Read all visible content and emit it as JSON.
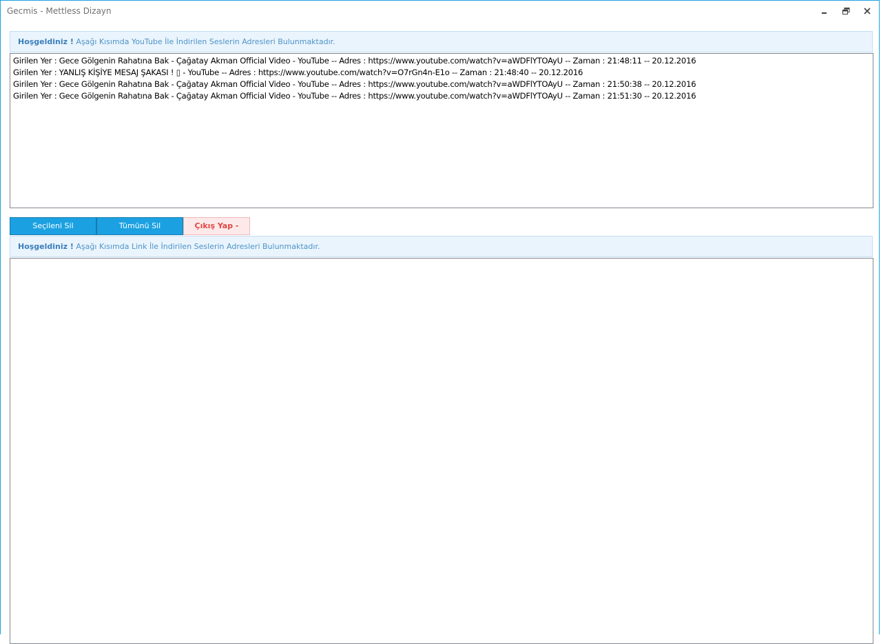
{
  "window": {
    "title": "Gecmis - Mettless Dizayn"
  },
  "icons": {
    "minimize": "minimize-icon",
    "maximize": "restore-icon",
    "close": "close-icon"
  },
  "colors": {
    "accent": "#1ba1e2",
    "banner_bg": "#eaf4fd",
    "exit_bg": "#fde9e9",
    "exit_text": "#e04646"
  },
  "youtube_section": {
    "banner_strong": "Hoşgeldiniz !",
    "banner_text": "Aşağı Kısımda YouTube İle İndirilen Seslerin Adresleri Bulunmaktadır.",
    "items": [
      "Girilen Yer : Gece Gölgenin Rahatına Bak - Çağatay Akman Official Video - YouTube -- Adres : https://www.youtube.com/watch?v=aWDFlYTOAyU -- Zaman : 21:48:11 -- 20.12.2016",
      "Girilen Yer : YANLIŞ KİŞİYE MESAJ ŞAKASI ! ▯ - YouTube -- Adres : https://www.youtube.com/watch?v=O7rGn4n-E1o -- Zaman : 21:48:40 -- 20.12.2016",
      "Girilen Yer : Gece Gölgenin Rahatına Bak - Çağatay Akman Official Video - YouTube -- Adres : https://www.youtube.com/watch?v=aWDFlYTOAyU -- Zaman : 21:50:38 -- 20.12.2016",
      "Girilen Yer : Gece Gölgenin Rahatına Bak - Çağatay Akman Official Video - YouTube -- Adres : https://www.youtube.com/watch?v=aWDFlYTOAyU -- Zaman : 21:51:30 -- 20.12.2016"
    ]
  },
  "buttons": {
    "delete_selected": "Seçileni Sil",
    "delete_all": "Tümünü Sil",
    "exit": "Çıkış Yap  -"
  },
  "link_section": {
    "banner_strong": "Hoşgeldiniz !",
    "banner_text": "Aşağı Kısımda Link İle İndirilen Seslerin Adresleri Bulunmaktadır.",
    "items": []
  }
}
